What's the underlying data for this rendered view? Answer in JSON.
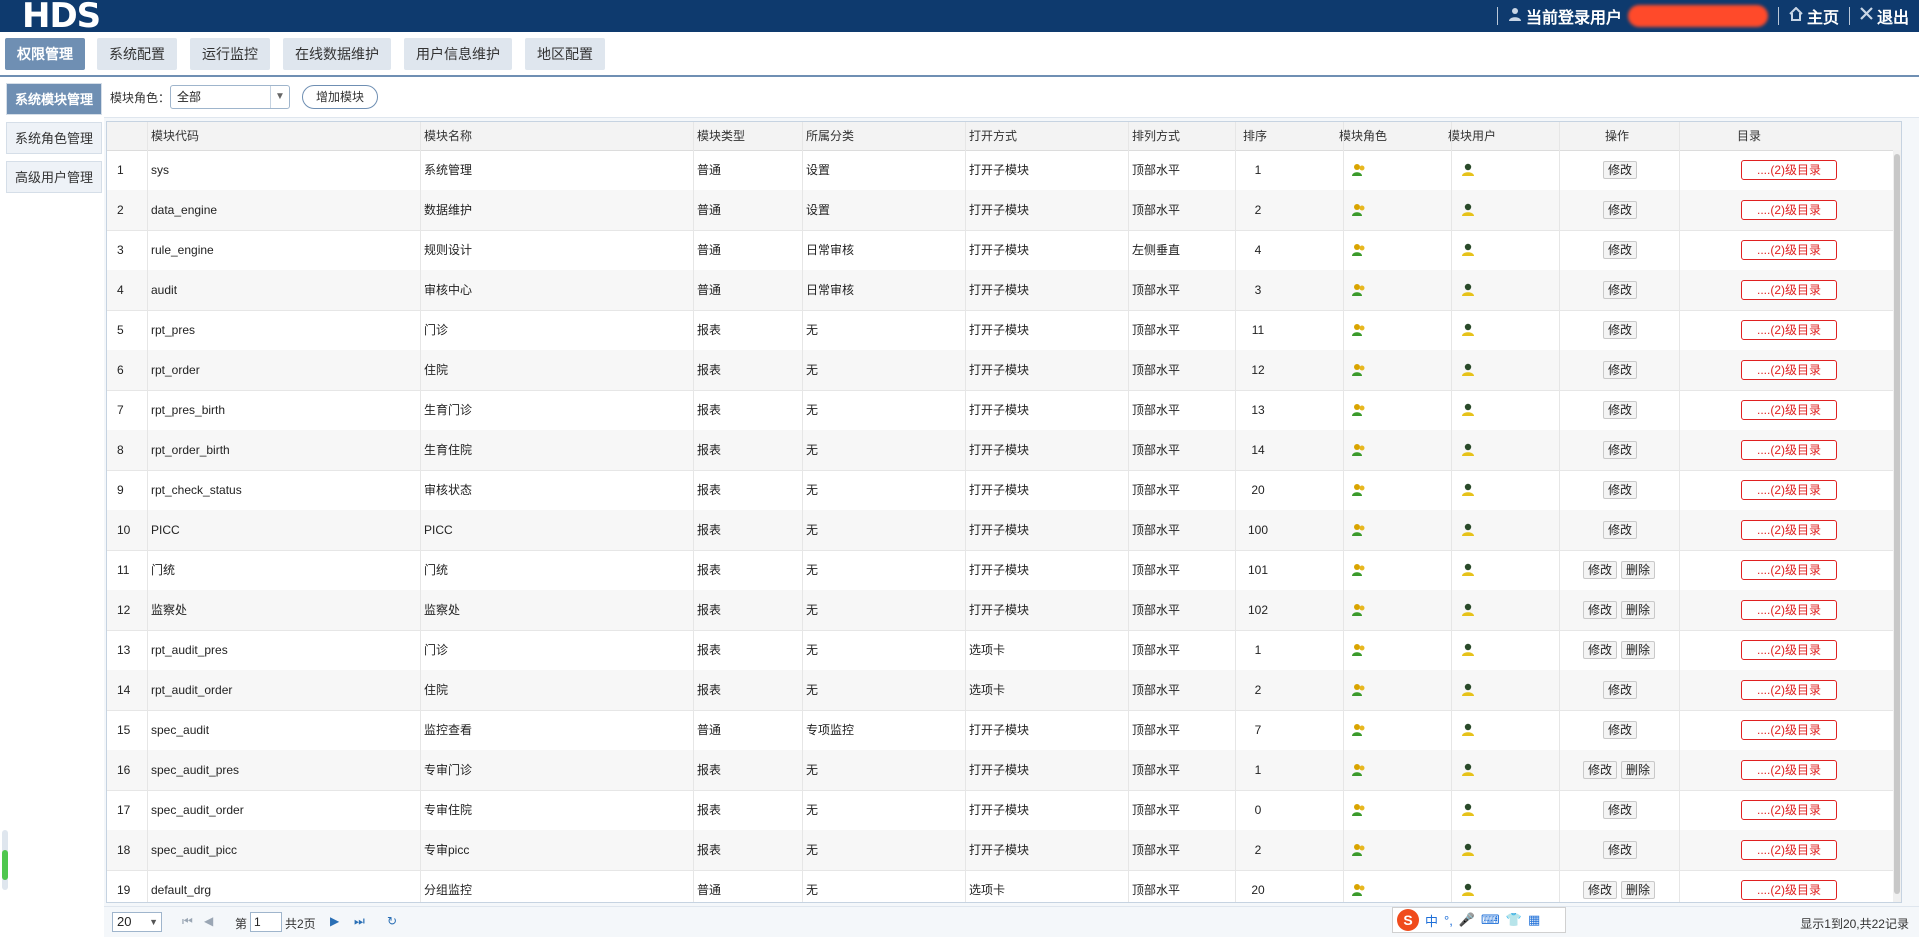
{
  "header": {
    "logo": "HDS",
    "current_user_label": "当前登录用户",
    "home_label": "主页",
    "logout_label": "退出",
    "colors": {
      "bar": "#0e3a6e",
      "redacted": "#ff4a2a"
    }
  },
  "nav": {
    "tabs": [
      {
        "label": "权限管理",
        "active": true
      },
      {
        "label": "系统配置",
        "active": false
      },
      {
        "label": "运行监控",
        "active": false
      },
      {
        "label": "在线数据维护",
        "active": false
      },
      {
        "label": "用户信息维护",
        "active": false
      },
      {
        "label": "地区配置",
        "active": false
      }
    ]
  },
  "sidebar": {
    "items": [
      {
        "label": "系统模块管理",
        "active": true
      },
      {
        "label": "系统角色管理",
        "active": false
      },
      {
        "label": "高级用户管理",
        "active": false
      }
    ]
  },
  "toolbar": {
    "role_label": "模块角色：",
    "role_value": "全部",
    "add_button": "增加模块"
  },
  "table": {
    "columns": [
      "模块代码",
      "模块名称",
      "模块类型",
      "所属分类",
      "打开方式",
      "排列方式",
      "排序",
      "模块角色",
      "模块用户",
      "操作",
      "目录"
    ],
    "edit_label": "修改",
    "delete_label": "删除",
    "dir_label": "....(2)级目录",
    "rows": [
      {
        "n": "1",
        "code": "sys",
        "name": "系统管理",
        "type": "普通",
        "cat": "设置",
        "open": "打开子模块",
        "arr": "顶部水平",
        "order": "1",
        "del": false
      },
      {
        "n": "2",
        "code": "data_engine",
        "name": "数据维护",
        "type": "普通",
        "cat": "设置",
        "open": "打开子模块",
        "arr": "顶部水平",
        "order": "2",
        "del": false
      },
      {
        "n": "3",
        "code": "rule_engine",
        "name": "规则设计",
        "type": "普通",
        "cat": "日常审核",
        "open": "打开子模块",
        "arr": "左侧垂直",
        "order": "4",
        "del": false
      },
      {
        "n": "4",
        "code": "audit",
        "name": "审核中心",
        "type": "普通",
        "cat": "日常审核",
        "open": "打开子模块",
        "arr": "顶部水平",
        "order": "3",
        "del": false
      },
      {
        "n": "5",
        "code": "rpt_pres",
        "name": "门诊",
        "type": "报表",
        "cat": "无",
        "open": "打开子模块",
        "arr": "顶部水平",
        "order": "11",
        "del": false
      },
      {
        "n": "6",
        "code": "rpt_order",
        "name": "住院",
        "type": "报表",
        "cat": "无",
        "open": "打开子模块",
        "arr": "顶部水平",
        "order": "12",
        "del": false
      },
      {
        "n": "7",
        "code": "rpt_pres_birth",
        "name": "生育门诊",
        "type": "报表",
        "cat": "无",
        "open": "打开子模块",
        "arr": "顶部水平",
        "order": "13",
        "del": false
      },
      {
        "n": "8",
        "code": "rpt_order_birth",
        "name": "生育住院",
        "type": "报表",
        "cat": "无",
        "open": "打开子模块",
        "arr": "顶部水平",
        "order": "14",
        "del": false
      },
      {
        "n": "9",
        "code": "rpt_check_status",
        "name": "审核状态",
        "type": "报表",
        "cat": "无",
        "open": "打开子模块",
        "arr": "顶部水平",
        "order": "20",
        "del": false
      },
      {
        "n": "10",
        "code": "PICC",
        "name": "PICC",
        "type": "报表",
        "cat": "无",
        "open": "打开子模块",
        "arr": "顶部水平",
        "order": "100",
        "del": false
      },
      {
        "n": "11",
        "code": "门统",
        "name": "门统",
        "type": "报表",
        "cat": "无",
        "open": "打开子模块",
        "arr": "顶部水平",
        "order": "101",
        "del": true
      },
      {
        "n": "12",
        "code": "监察处",
        "name": "监察处",
        "type": "报表",
        "cat": "无",
        "open": "打开子模块",
        "arr": "顶部水平",
        "order": "102",
        "del": true
      },
      {
        "n": "13",
        "code": "rpt_audit_pres",
        "name": "门诊",
        "type": "报表",
        "cat": "无",
        "open": "选项卡",
        "arr": "顶部水平",
        "order": "1",
        "del": true
      },
      {
        "n": "14",
        "code": "rpt_audit_order",
        "name": "住院",
        "type": "报表",
        "cat": "无",
        "open": "选项卡",
        "arr": "顶部水平",
        "order": "2",
        "del": false
      },
      {
        "n": "15",
        "code": "spec_audit",
        "name": "监控查看",
        "type": "普通",
        "cat": "专项监控",
        "open": "打开子模块",
        "arr": "顶部水平",
        "order": "7",
        "del": false
      },
      {
        "n": "16",
        "code": "spec_audit_pres",
        "name": "专审门诊",
        "type": "报表",
        "cat": "无",
        "open": "打开子模块",
        "arr": "顶部水平",
        "order": "1",
        "del": true
      },
      {
        "n": "17",
        "code": "spec_audit_order",
        "name": "专审住院",
        "type": "报表",
        "cat": "无",
        "open": "打开子模块",
        "arr": "顶部水平",
        "order": "0",
        "del": false
      },
      {
        "n": "18",
        "code": "spec_audit_picc",
        "name": "专审picc",
        "type": "报表",
        "cat": "无",
        "open": "打开子模块",
        "arr": "顶部水平",
        "order": "2",
        "del": false
      },
      {
        "n": "19",
        "code": "default_drg",
        "name": "分组监控",
        "type": "普通",
        "cat": "无",
        "open": "选项卡",
        "arr": "顶部水平",
        "order": "20",
        "del": true
      }
    ]
  },
  "pager": {
    "page_size": "20",
    "page_prefix": "第",
    "page_value": "1",
    "page_total": "共2页",
    "info": "显示1到20,共22记录"
  },
  "ime": {
    "logo": "S",
    "items": [
      "中",
      "°,",
      "🎤",
      "⌨",
      "👕",
      "▦"
    ]
  }
}
